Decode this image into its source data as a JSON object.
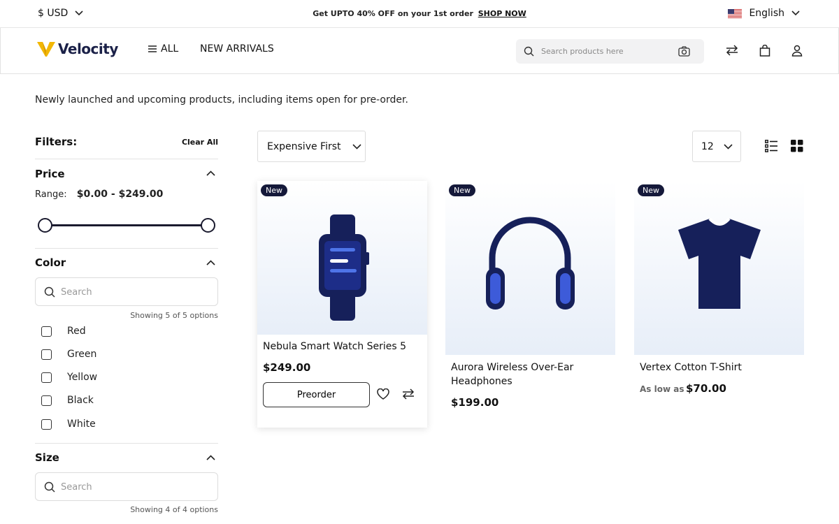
{
  "topbar": {
    "currency": "$ USD",
    "promo_text": "Get UPTO 40% OFF on your 1st order",
    "promo_link": "SHOP NOW",
    "language": "English"
  },
  "header": {
    "logo_text": "Velocity",
    "nav_all": "ALL",
    "nav_new": "NEW ARRIVALS",
    "search_placeholder": "Search products here"
  },
  "intro": "Newly launched and upcoming products, including items open for pre-order.",
  "filters": {
    "title": "Filters:",
    "clear_all": "Clear All",
    "price": {
      "title": "Price",
      "range_label": "Range:",
      "range_value": "$0.00 - $249.00",
      "min_fraction": 0,
      "max_fraction": 1
    },
    "color": {
      "title": "Color",
      "search_placeholder": "Search",
      "showing": "Showing 5 of 5 options",
      "options": [
        "Red",
        "Green",
        "Yellow",
        "Black",
        "White"
      ]
    },
    "size": {
      "title": "Size",
      "search_placeholder": "Search",
      "showing": "Showing 4 of 4 options"
    }
  },
  "toolbar": {
    "sort": "Expensive First",
    "per_page": "12"
  },
  "products": [
    {
      "badge": "New",
      "name": "Nebula Smart Watch Series 5",
      "price": "$249.00",
      "button": "Preorder",
      "image": "smartwatch"
    },
    {
      "badge": "New",
      "name": "Aurora Wireless Over-Ear Headphones",
      "price": "$199.00",
      "image": "headphones"
    },
    {
      "badge": "New",
      "name": "Vertex Cotton T-Shirt",
      "price_prefix": "As low as",
      "price": "$70.00",
      "image": "t-shirt"
    }
  ],
  "colors": {
    "navy": "#16205a",
    "accent": "#3d5bd9",
    "badge": "#15193a",
    "logo_gold": "#f2b705"
  }
}
